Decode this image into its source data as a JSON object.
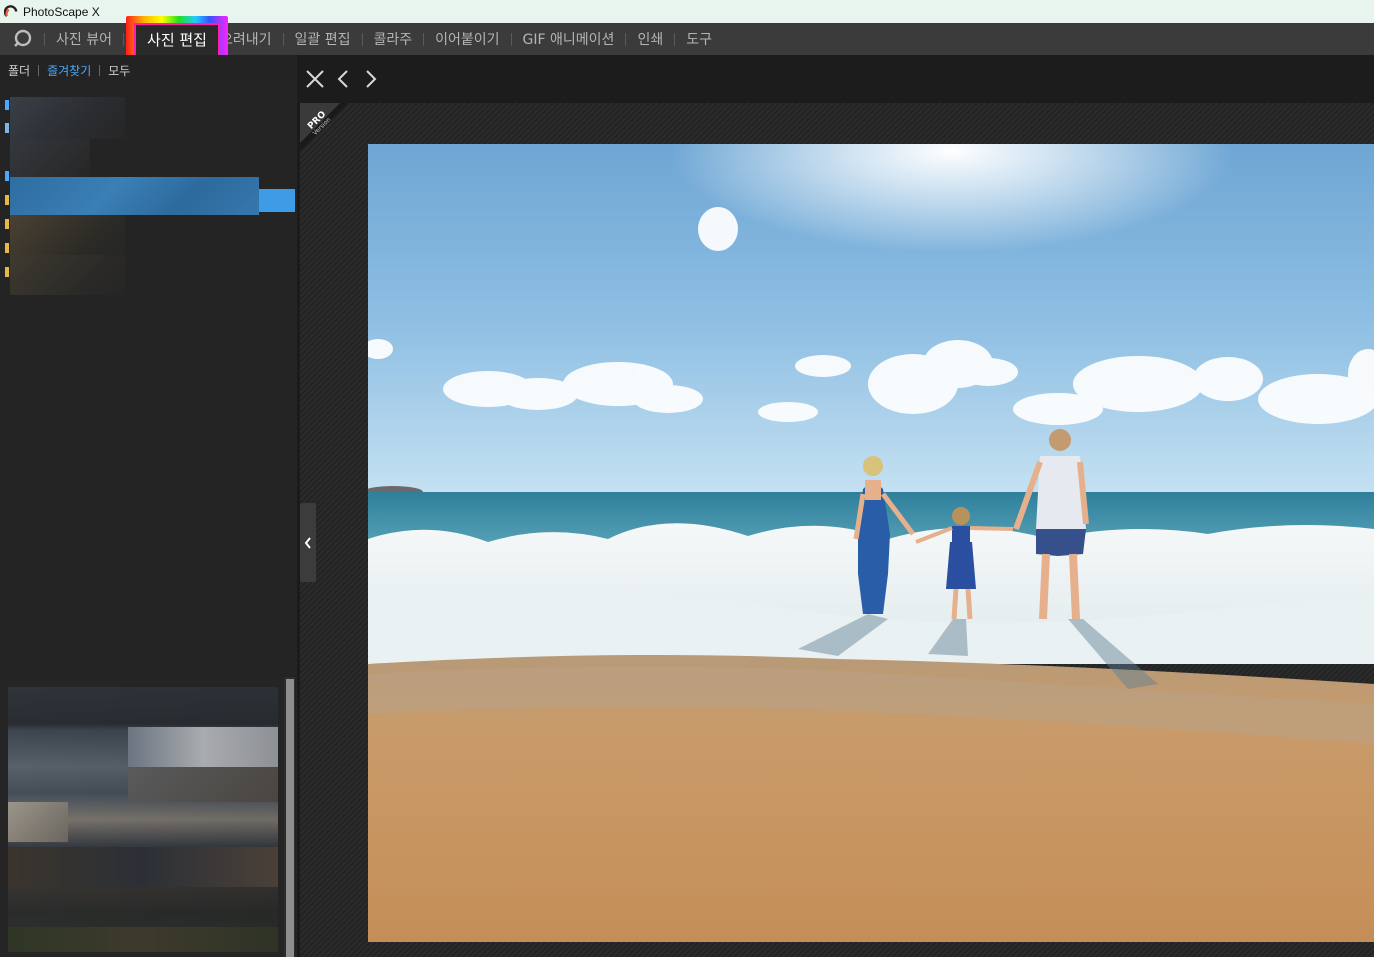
{
  "app": {
    "title": "PhotoScape X"
  },
  "menu": {
    "home_icon": "photoscape-home-icon",
    "items": [
      {
        "label": "사진 뷰어"
      },
      {
        "label": "사진 편집",
        "active": true
      },
      {
        "label": "오려내기"
      },
      {
        "label": "일괄 편집"
      },
      {
        "label": "콜라주"
      },
      {
        "label": "이어붙이기"
      },
      {
        "label": "GIF 애니메이션"
      },
      {
        "label": "인쇄"
      },
      {
        "label": "도구"
      }
    ],
    "highlight_colors": [
      "#ff1e1e",
      "#ffff00",
      "#22dd22",
      "#22ccff",
      "#3355ff",
      "#ff22ff"
    ]
  },
  "left": {
    "tabs": [
      {
        "label": "폴더"
      },
      {
        "label": "즐겨찾기",
        "active": true
      },
      {
        "label": "모두"
      }
    ],
    "selected_color": "#3e9be6"
  },
  "viewer": {
    "badge_line1": "PRO",
    "badge_line2": "Version",
    "close_icon": "close-icon",
    "prev_icon": "chevron-left-icon",
    "next_icon": "chevron-right-icon",
    "collapse_icon": "chevron-left-icon"
  },
  "photo": {
    "subject": "beach-family-photo"
  }
}
